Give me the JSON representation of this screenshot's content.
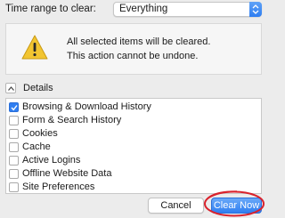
{
  "time_range": {
    "label": "Time range to clear:",
    "value": "Everything"
  },
  "warning": {
    "line1": "All selected items will be cleared.",
    "line2": "This action cannot be undone.",
    "icon": "warning-triangle-icon"
  },
  "details": {
    "label": "Details",
    "expanded": true
  },
  "items": [
    {
      "label": "Browsing & Download History",
      "checked": true
    },
    {
      "label": "Form & Search History",
      "checked": false
    },
    {
      "label": "Cookies",
      "checked": false
    },
    {
      "label": "Cache",
      "checked": false
    },
    {
      "label": "Active Logins",
      "checked": false
    },
    {
      "label": "Offline Website Data",
      "checked": false
    },
    {
      "label": "Site Preferences",
      "checked": false
    }
  ],
  "buttons": {
    "cancel": "Cancel",
    "clear_now": "Clear Now"
  },
  "colors": {
    "accent": "#2f7ef1",
    "annotation": "#d9232d",
    "warning_yellow": "#f2c531"
  }
}
